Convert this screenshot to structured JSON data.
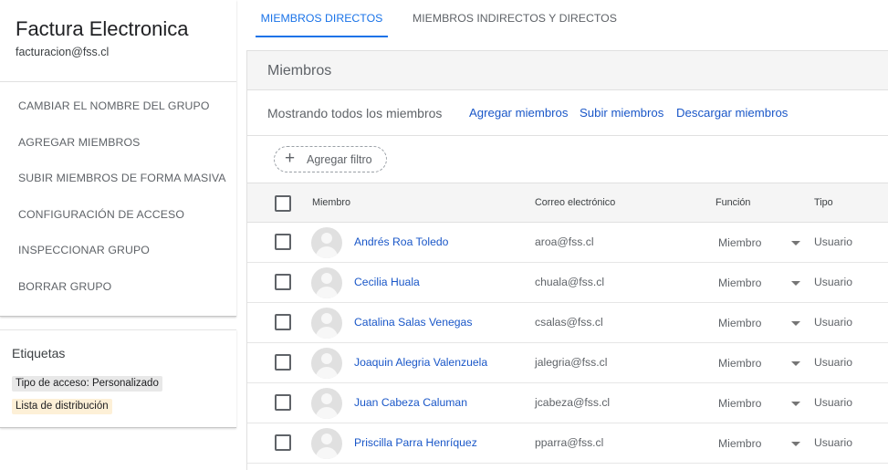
{
  "group": {
    "name": "Factura Electronica",
    "email": "facturacion@fss.cl"
  },
  "sidebar": {
    "items": [
      {
        "label": "CAMBIAR EL NOMBRE DEL GRUPO"
      },
      {
        "label": "AGREGAR MIEMBROS"
      },
      {
        "label": "SUBIR MIEMBROS DE FORMA MASIVA"
      },
      {
        "label": "CONFIGURACIÓN DE ACCESO"
      },
      {
        "label": "INSPECCIONAR GRUPO"
      },
      {
        "label": "BORRAR GRUPO"
      }
    ]
  },
  "labels": {
    "title": "Etiquetas",
    "chips": [
      {
        "label": "Tipo de acceso: Personalizado"
      },
      {
        "label": "Lista de distribución"
      }
    ]
  },
  "tabs": [
    {
      "label": "MIEMBROS DIRECTOS",
      "active": true
    },
    {
      "label": "MIEMBROS INDIRECTOS Y DIRECTOS",
      "active": false
    }
  ],
  "members_panel": {
    "title": "Miembros",
    "showing_text": "Mostrando todos los miembros",
    "actions": {
      "add": "Agregar miembros",
      "upload": "Subir miembros",
      "download": "Descargar miembros"
    },
    "filter": {
      "icon": "plus-icon",
      "label": "Agregar filtro"
    }
  },
  "table": {
    "headers": {
      "member": "Miembro",
      "email": "Correo electrónico",
      "role": "Función",
      "type": "Tipo"
    },
    "rows": [
      {
        "name": "Andrés Roa Toledo",
        "email": "aroa@fss.cl",
        "role": "Miembro",
        "type": "Usuario"
      },
      {
        "name": "Cecilia Huala",
        "email": "chuala@fss.cl",
        "role": "Miembro",
        "type": "Usuario"
      },
      {
        "name": "Catalina Salas Venegas",
        "email": "csalas@fss.cl",
        "role": "Miembro",
        "type": "Usuario"
      },
      {
        "name": "Joaquin Alegria Valenzuela",
        "email": "jalegria@fss.cl",
        "role": "Miembro",
        "type": "Usuario"
      },
      {
        "name": "Juan Cabeza Caluman",
        "email": "jcabeza@fss.cl",
        "role": "Miembro",
        "type": "Usuario"
      },
      {
        "name": "Priscilla Parra Henríquez",
        "email": "pparra@fss.cl",
        "role": "Miembro",
        "type": "Usuario"
      }
    ]
  },
  "colors": {
    "accent": "#1a73e8",
    "link": "#1a57c8",
    "header_bg": "#f5f5f5",
    "chip_access_bg": "#e8e8e8",
    "chip_distribution_bg": "#fdf0d7"
  }
}
